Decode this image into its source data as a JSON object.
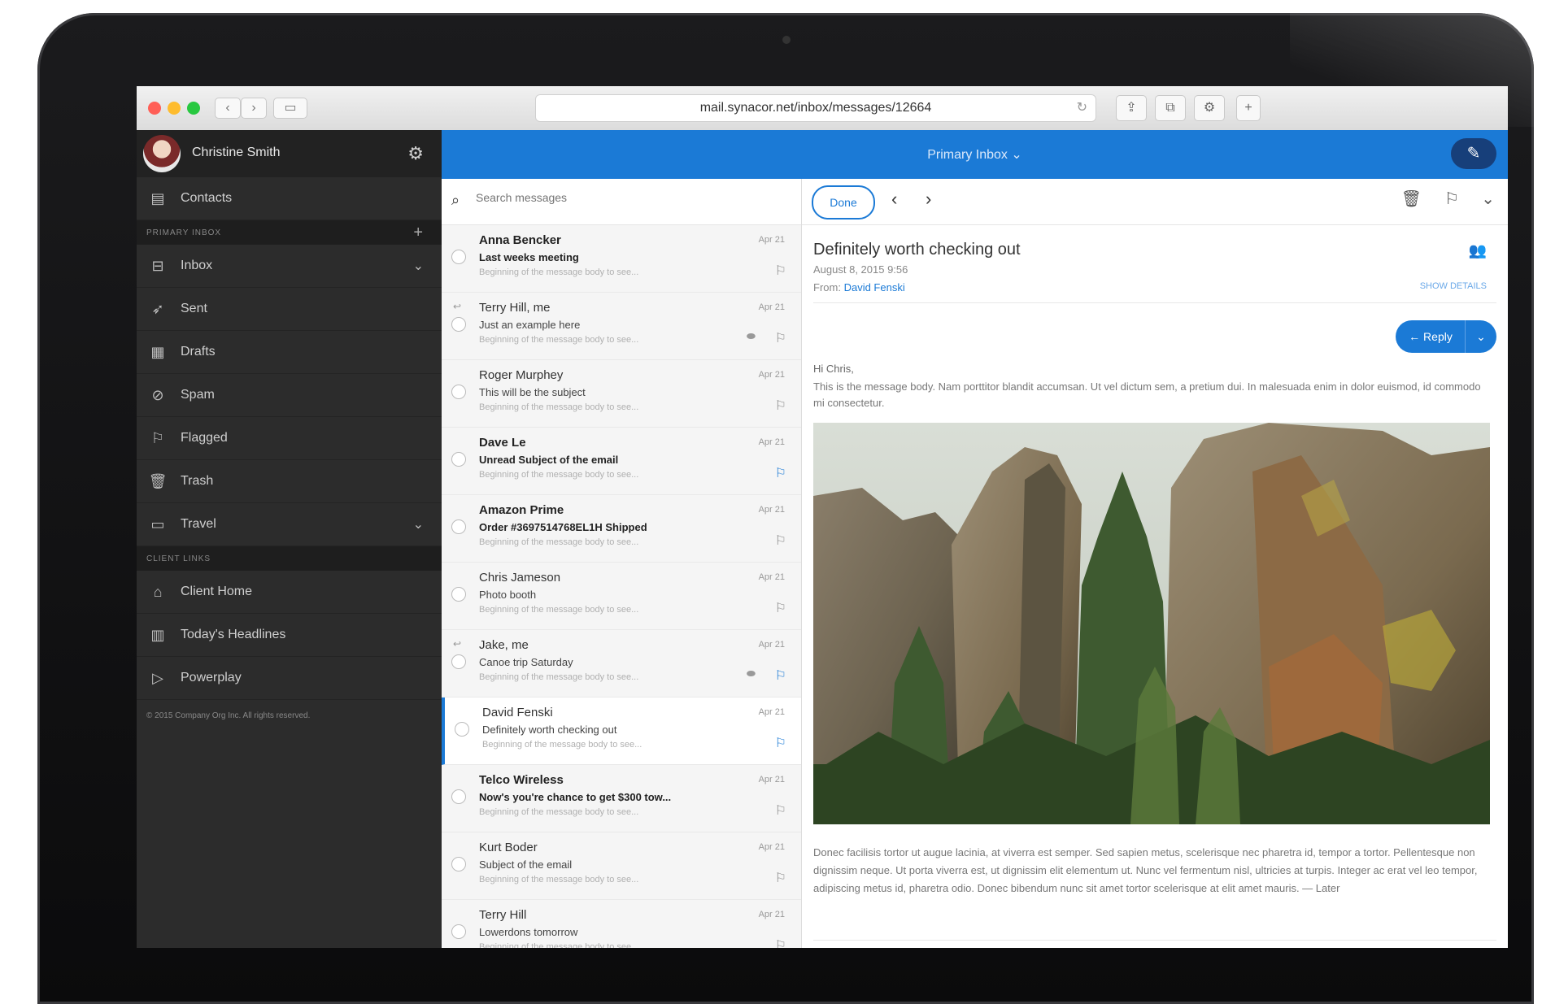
{
  "browser": {
    "url": "mail.synacor.net/inbox/messages/12664",
    "colors": {
      "close": "#ff5f57",
      "minimize": "#febc2e",
      "zoom": "#28c840"
    }
  },
  "sidebar": {
    "user_name": "Christine Smith",
    "items_top": [
      {
        "label": "Contacts",
        "icon": "contacts-icon"
      }
    ],
    "section_primary": "PRIMARY INBOX",
    "folders": [
      {
        "label": "Inbox",
        "icon": "inbox-icon",
        "expandable": true
      },
      {
        "label": "Sent",
        "icon": "sent-icon"
      },
      {
        "label": "Drafts",
        "icon": "drafts-icon"
      },
      {
        "label": "Spam",
        "icon": "spam-icon"
      },
      {
        "label": "Flagged",
        "icon": "flag-icon"
      },
      {
        "label": "Trash",
        "icon": "trash-icon"
      },
      {
        "label": "Travel",
        "icon": "folder-icon",
        "expandable": true
      }
    ],
    "section_client": "CLIENT LINKS",
    "client_links": [
      {
        "label": "Client Home",
        "icon": "home-icon"
      },
      {
        "label": "Today's Headlines",
        "icon": "news-icon"
      },
      {
        "label": "Powerplay",
        "icon": "play-icon"
      }
    ],
    "copyright": "© 2015 Company Org Inc. All rights reserved."
  },
  "header": {
    "title": "Primary Inbox",
    "accent": "#1b7ad6"
  },
  "search": {
    "placeholder": "Search messages"
  },
  "messages": [
    {
      "sender": "Anna Bencker",
      "subject": "Last weeks meeting",
      "preview": "Beginning of the message body to see...",
      "date": "Apr 21",
      "unread": true,
      "flag": "grey"
    },
    {
      "sender": "Terry Hill, me",
      "subject": "Just an example here",
      "preview": "Beginning of the message body to see...",
      "date": "Apr 21",
      "replied": true,
      "attachment": true,
      "flag": "grey"
    },
    {
      "sender": "Roger Murphey",
      "subject": "This will be the subject",
      "preview": "Beginning of the message body to see...",
      "date": "Apr 21",
      "flag": "grey"
    },
    {
      "sender": "Dave Le",
      "subject": "Unread Subject of the email",
      "preview": "Beginning of the message body to see...",
      "date": "Apr 21",
      "unread": true,
      "flag": "blue"
    },
    {
      "sender": "Amazon Prime",
      "subject": "Order #3697514768EL1H Shipped",
      "preview": "Beginning of the message body to see...",
      "date": "Apr 21",
      "unread": true,
      "flag": "grey"
    },
    {
      "sender": "Chris Jameson",
      "subject": "Photo booth",
      "preview": "Beginning of the message body to see...",
      "date": "Apr 21",
      "flag": "grey"
    },
    {
      "sender": "Jake, me",
      "subject": "Canoe trip Saturday",
      "preview": "Beginning of the message body to see...",
      "date": "Apr 21",
      "replied": true,
      "attachment": true,
      "flag": "blue"
    },
    {
      "sender": "David Fenski",
      "subject": "Definitely worth checking out",
      "preview": "Beginning of the message body to see...",
      "date": "Apr 21",
      "selected": true,
      "flag": "blue"
    },
    {
      "sender": "Telco Wireless",
      "subject": "Now's you're chance to get $300 tow...",
      "preview": "Beginning of the message body to see...",
      "date": "Apr 21",
      "unread": true,
      "flag": "grey"
    },
    {
      "sender": "Kurt Boder",
      "subject": "Subject of the email",
      "preview": "Beginning of the message body to see...",
      "date": "Apr 21",
      "flag": "grey"
    },
    {
      "sender": "Terry Hill",
      "subject": "Lowerdons tomorrow",
      "preview": "Beginning of the message body to see...",
      "date": "Apr 21",
      "flag": "grey"
    }
  ],
  "reading": {
    "done_label": "Done",
    "subject": "Definitely worth checking out",
    "date": "August 8, 2015 9:56",
    "from_label": "From:",
    "from_name": "David Fenski",
    "show_details": "SHOW DETAILS",
    "reply_label": "← Reply",
    "greeting": "Hi Chris,",
    "body_1": "This is the message body. Nam porttitor blandit accumsan. Ut vel dictum sem, a pretium dui. In malesuada enim in dolor euismod, id commodo mi consectetur.",
    "body_2": "Donec facilisis tortor ut augue lacinia, at viverra est semper. Sed sapien metus, scelerisque nec pharetra id, tempor a tortor. Pellentesque non dignissim neque. Ut porta viverra est, ut dignissim elit elementum ut. Nunc vel fermentum nisl, ultricies at turpis. Integer ac erat vel leo tempor, adipiscing metus id, pharetra odio. Donec bibendum nunc sit amet tortor scelerisque at elit amet mauris. — Later"
  }
}
